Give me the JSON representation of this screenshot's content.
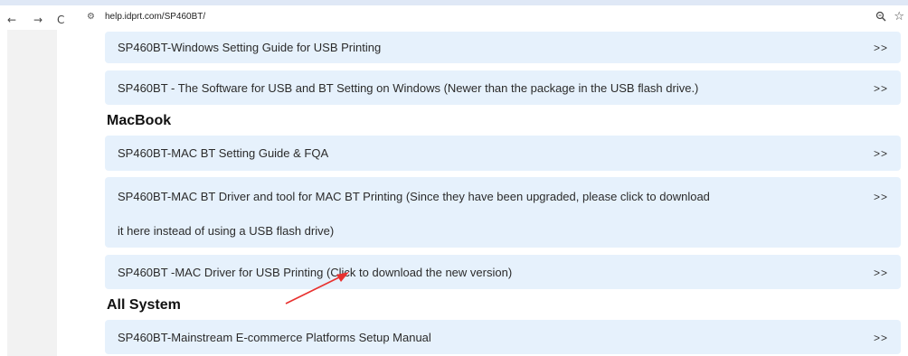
{
  "browser": {
    "back": "←",
    "forward": "→",
    "reload": "C",
    "site_icon": "⚙",
    "url": "help.idprt.com/SP460BT/",
    "zoom_icon": "zoom-icon",
    "star_icon": "star-icon"
  },
  "sections": {
    "top_items": [
      {
        "label": "SP460BT-Windows Setting Guide for USB Printing",
        "chevron": ">>"
      },
      {
        "label": "SP460BT - The Software for USB and BT Setting on Windows   (Newer than the package in the USB flash drive.)",
        "chevron": ">>"
      }
    ],
    "macbook": {
      "title": "MacBook",
      "items": [
        {
          "label": "SP460BT-MAC BT Setting Guide & FQA",
          "chevron": ">>"
        },
        {
          "label_line1": "SP460BT-MAC BT Driver and tool for MAC BT Printing (Since they have been upgraded, please click to download",
          "label_line2": "it here instead of using a USB flash drive)",
          "chevron": ">>"
        },
        {
          "label": "SP460BT -MAC Driver for USB Printing (Click to download the new version)",
          "chevron": ">>"
        }
      ]
    },
    "all_system": {
      "title": "All System",
      "items": [
        {
          "label": "SP460BT-Mainstream E-commerce Platforms Setup Manual",
          "chevron": ">>"
        }
      ]
    }
  },
  "colors": {
    "row_background": "#e6f1fc",
    "annotation_arrow": "#e8312f"
  }
}
